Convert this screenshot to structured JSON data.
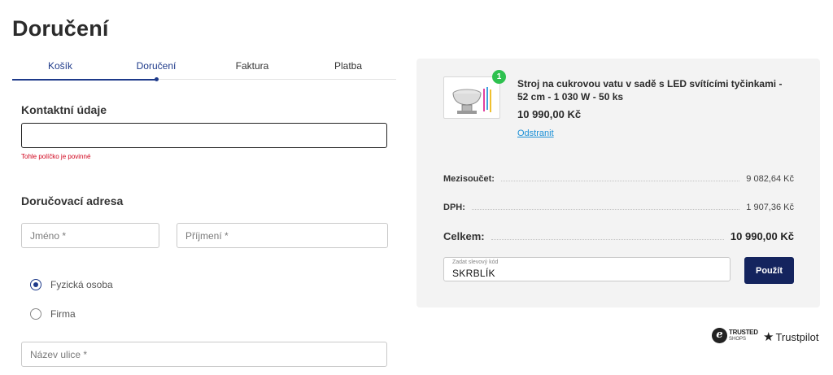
{
  "page": {
    "title": "Doručení"
  },
  "steps": [
    {
      "label": "Košík"
    },
    {
      "label": "Doručení"
    },
    {
      "label": "Faktura"
    },
    {
      "label": "Platba"
    }
  ],
  "contact": {
    "heading": "Kontaktní údaje",
    "email_value": "",
    "error": "Tohle políčko je povinné"
  },
  "address": {
    "heading": "Doručovací adresa",
    "first_name_placeholder": "Jméno *",
    "last_name_placeholder": "Příjmení *",
    "person_type": [
      {
        "label": "Fyzická osoba",
        "checked": true
      },
      {
        "label": "Firma",
        "checked": false
      }
    ],
    "street_placeholder": "Název ulice *"
  },
  "summary": {
    "product": {
      "name": "Stroj na cukrovou vatu v sadě s LED svítícími tyčinkami - 52 cm - 1 030 W - 50 ks",
      "price": "10 990,00 Kč",
      "quantity": "1",
      "remove_label": "Odstranit",
      "thumb_icon": "cotton-candy-machine-icon"
    },
    "subtotal_label": "Mezisoučet:",
    "subtotal_value": "9 082,64 Kč",
    "vat_label": "DPH:",
    "vat_value": "1 907,36 Kč",
    "total_label": "Celkem:",
    "total_value": "10 990,00 Kč",
    "coupon_label": "Zadat slevový kód",
    "coupon_value": "SKRBLÍK",
    "apply_label": "Použít"
  },
  "badges": {
    "trusted_line1": "TRUSTED",
    "trusted_line2": "SHOPS",
    "trustpilot": "Trustpilot"
  },
  "colors": {
    "accent": "#1e3a8a",
    "button": "#14245e",
    "error": "#d0021b",
    "badge": "#2ec14f",
    "link": "#1a8fd6"
  }
}
